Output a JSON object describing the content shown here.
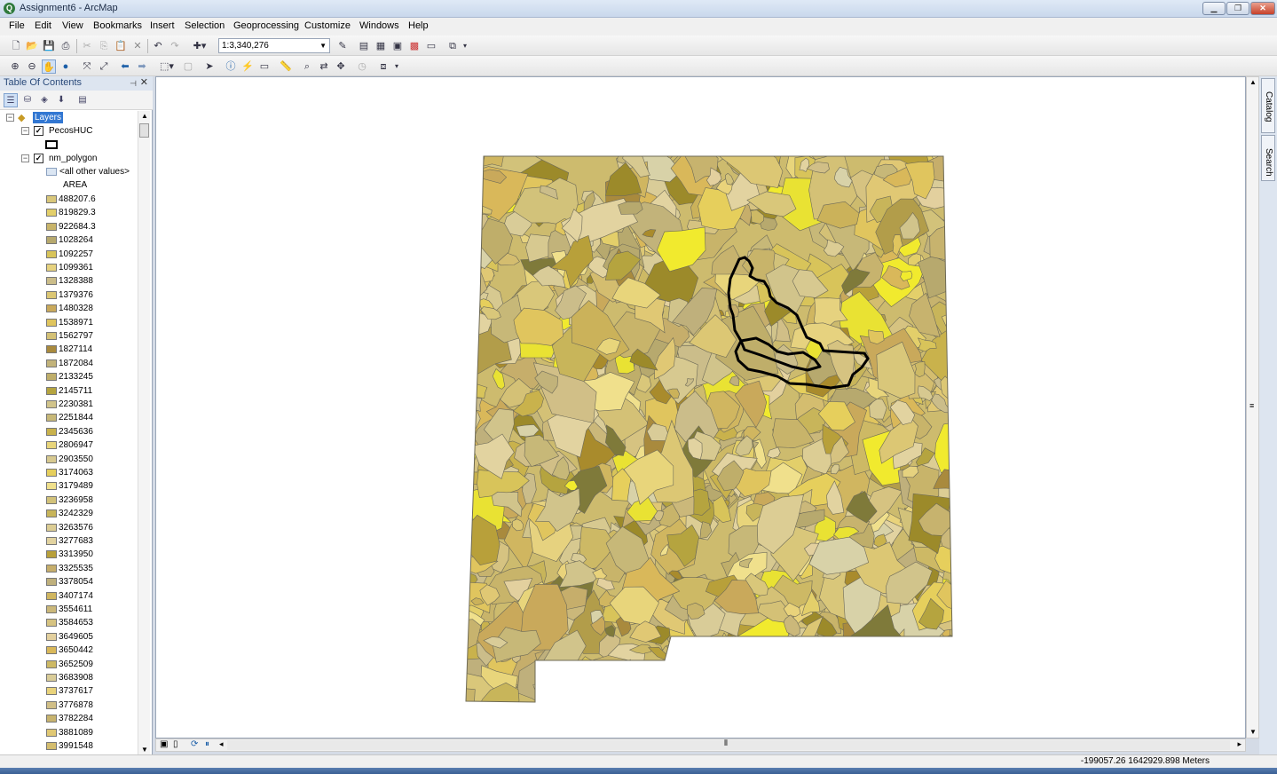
{
  "window": {
    "title": "Assignment6 - ArcMap",
    "app_icon": "arcmap-globe-icon"
  },
  "menu": [
    "File",
    "Edit",
    "View",
    "Bookmarks",
    "Insert",
    "Selection",
    "Geoprocessing",
    "Customize",
    "Windows",
    "Help"
  ],
  "standard_toolbar": {
    "scale": "1:3,340,276"
  },
  "toc": {
    "title": "Table Of Contents",
    "root": "Layers",
    "layers": [
      {
        "name": "PecosHUC",
        "checked": true
      },
      {
        "name": "nm_polygon",
        "checked": true
      }
    ],
    "all_other_values": "<all other values>",
    "field": "AREA",
    "classes": [
      "488207.6",
      "819829.3",
      "922684.3",
      "1028264",
      "1092257",
      "1099361",
      "1328388",
      "1379376",
      "1480328",
      "1538971",
      "1562797",
      "1827114",
      "1872084",
      "2133245",
      "2145711",
      "2230381",
      "2251844",
      "2345636",
      "2806947",
      "2903550",
      "3174063",
      "3179489",
      "3236958",
      "3242329",
      "3263576",
      "3277683",
      "3313950",
      "3325535",
      "3378054",
      "3407174",
      "3554611",
      "3584653",
      "3649605",
      "3650442",
      "3652509",
      "3683908",
      "3737617",
      "3776878",
      "3782284",
      "3881089",
      "3991548"
    ],
    "class_colors": [
      "#d9c77a",
      "#e3cf6a",
      "#c8b46a",
      "#b7a96e",
      "#d8c45a",
      "#e6d27f",
      "#cbbd8a",
      "#dcc774",
      "#c9a95b",
      "#e0c55e",
      "#d4c176",
      "#a98a3d",
      "#c2b37a",
      "#bfae6a",
      "#b5a43f",
      "#d1c48b",
      "#c7b878",
      "#c9b24c",
      "#e8d57b",
      "#d7c990",
      "#e6cf5c",
      "#f0e08c",
      "#d2c27a",
      "#c8b55a",
      "#dccd94",
      "#e2d3a0",
      "#b8a03a",
      "#c6ae6b",
      "#bfb07c",
      "#d0b660",
      "#cbb87a",
      "#d6c381",
      "#e3d09e",
      "#d9b85a",
      "#cdb965",
      "#d9cc98",
      "#e9d37b",
      "#d1bf87",
      "#c7b36e",
      "#e0c874",
      "#d4bd6f"
    ]
  },
  "dock_tabs": [
    "Catalog",
    "Search"
  ],
  "status": {
    "coordinates": "-199057.26  1642929.898 Meters"
  }
}
